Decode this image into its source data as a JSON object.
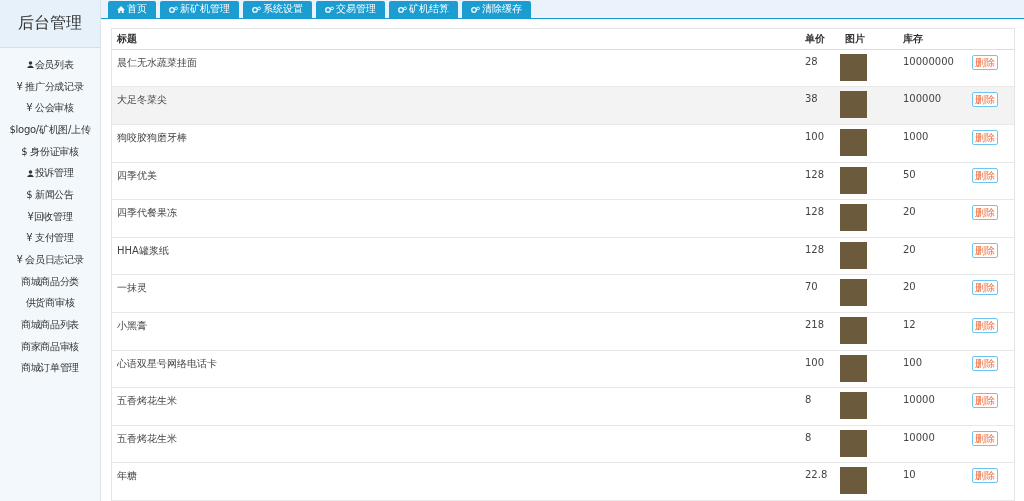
{
  "sidebar": {
    "title": "后台管理",
    "items": [
      {
        "kind": "user",
        "label": "会员列表"
      },
      {
        "kind": "plain",
        "label": "¥ 推广分成记录"
      },
      {
        "kind": "plain",
        "label": "¥ 公会审核"
      },
      {
        "kind": "plain",
        "label": "$logo/矿机图/上传"
      },
      {
        "kind": "plain",
        "label": "$ 身份证审核"
      },
      {
        "kind": "user",
        "label": "投诉管理"
      },
      {
        "kind": "plain",
        "label": "$ 新闻公告"
      },
      {
        "kind": "plain",
        "label": "¥回收管理"
      },
      {
        "kind": "plain",
        "label": "¥ 支付管理"
      },
      {
        "kind": "plain",
        "label": "¥ 会员日志记录"
      },
      {
        "kind": "plain",
        "label": "商城商品分类"
      },
      {
        "kind": "plain",
        "label": "供货商审核"
      },
      {
        "kind": "plain",
        "label": "商城商品列表"
      },
      {
        "kind": "plain",
        "label": "商家商品审核"
      },
      {
        "kind": "plain",
        "label": "商城订单管理"
      }
    ]
  },
  "tabs": [
    {
      "kind": "home",
      "label": "首页"
    },
    {
      "kind": "settings",
      "label": "新矿机管理"
    },
    {
      "kind": "settings",
      "label": "系统设置"
    },
    {
      "kind": "settings",
      "label": "交易管理"
    },
    {
      "kind": "settings",
      "label": "矿机结算"
    },
    {
      "kind": "settings",
      "label": "清除缓存"
    }
  ],
  "table": {
    "columns": [
      "标题",
      "单价",
      "图片",
      "库存"
    ],
    "rows": [
      {
        "title": "晨仁无水蔬菜挂面",
        "price": "28",
        "stock": "10000000",
        "action": "删除",
        "highlighted": false
      },
      {
        "title": "大足冬菜尖",
        "price": "38",
        "stock": "100000",
        "action": "删除",
        "highlighted": true
      },
      {
        "title": "狗咬胶狗磨牙棒",
        "price": "100",
        "stock": "1000",
        "action": "删除",
        "highlighted": false
      },
      {
        "title": "四季优美",
        "price": "128",
        "stock": "50",
        "action": "删除",
        "highlighted": false
      },
      {
        "title": "四季代餐果冻",
        "price": "128",
        "stock": "20",
        "action": "删除",
        "highlighted": false
      },
      {
        "title": "HHA罐浆纸",
        "price": "128",
        "stock": "20",
        "action": "删除",
        "highlighted": false
      },
      {
        "title": "一抹灵",
        "price": "70",
        "stock": "20",
        "action": "删除",
        "highlighted": false
      },
      {
        "title": "小黑膏",
        "price": "218",
        "stock": "12",
        "action": "删除",
        "highlighted": false
      },
      {
        "title": "心语双星号网络电话卡",
        "price": "100",
        "stock": "100",
        "action": "删除",
        "highlighted": false
      },
      {
        "title": "五香烤花生米",
        "price": "8",
        "stock": "10000",
        "action": "删除",
        "highlighted": false
      },
      {
        "title": "五香烤花生米",
        "price": "8",
        "stock": "10000",
        "action": "删除",
        "highlighted": false
      },
      {
        "title": "年糖",
        "price": "22.8",
        "stock": "10",
        "action": "删除",
        "highlighted": false
      }
    ]
  }
}
